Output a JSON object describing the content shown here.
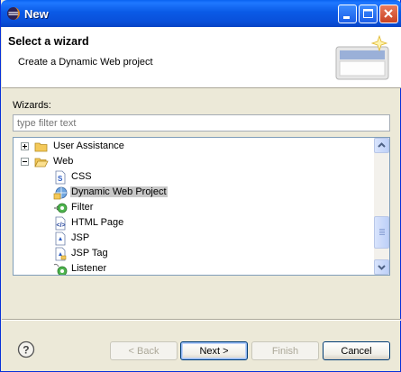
{
  "window": {
    "title": "New"
  },
  "header": {
    "title": "Select a wizard",
    "description": "Create a Dynamic Web project"
  },
  "wizards": {
    "label": "Wizards:",
    "filter_placeholder": "type filter text"
  },
  "tree": {
    "items": [
      {
        "label": "User Assistance",
        "icon": "folder-icon",
        "expanded": false
      },
      {
        "label": "Web",
        "icon": "folder-open-icon",
        "expanded": true
      },
      {
        "label": "CSS",
        "icon": "css-file-icon"
      },
      {
        "label": "Dynamic Web Project",
        "icon": "web-project-icon",
        "selected": true
      },
      {
        "label": "Filter",
        "icon": "filter-icon"
      },
      {
        "label": "HTML Page",
        "icon": "html-page-icon"
      },
      {
        "label": "JSP",
        "icon": "jsp-file-icon"
      },
      {
        "label": "JSP Tag",
        "icon": "jsp-tag-icon"
      },
      {
        "label": "Listener",
        "icon": "listener-icon"
      }
    ]
  },
  "buttons": {
    "back": "< Back",
    "next": "Next >",
    "finish": "Finish",
    "cancel": "Cancel"
  },
  "colors": {
    "titlebar": "#0a5ae6",
    "selection": "#c8c8c8",
    "folder": "#f4c95a"
  }
}
